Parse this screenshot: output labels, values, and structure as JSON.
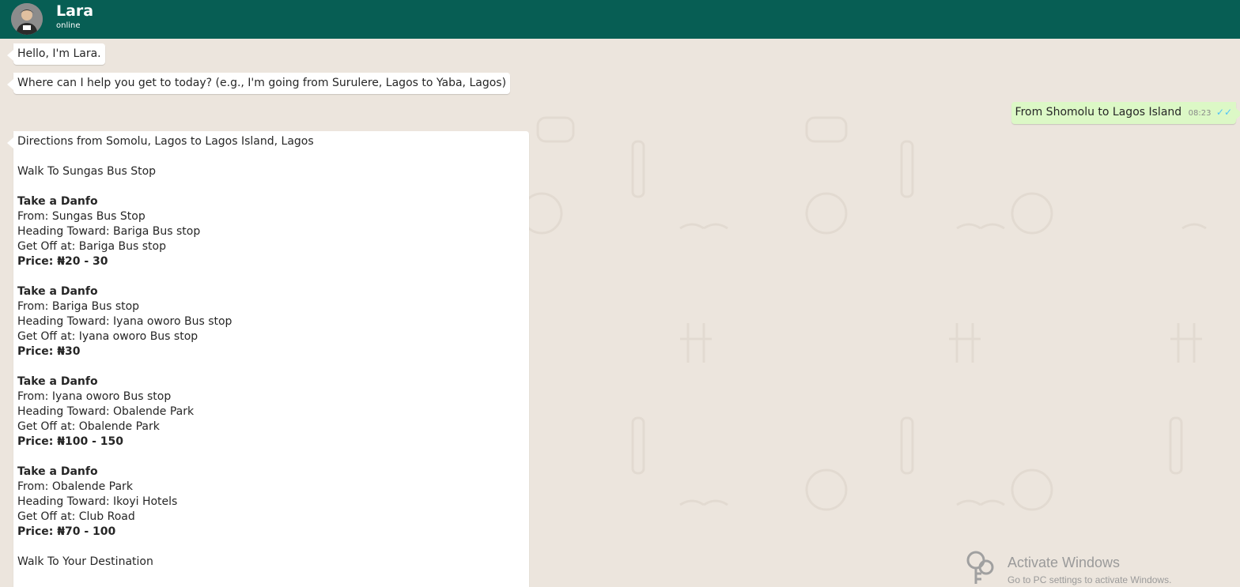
{
  "contact": {
    "name": "Lara",
    "status": "online"
  },
  "messages": {
    "greeting": "Hello, I'm Lara.",
    "prompt": "Where can I help you get to today? (e.g., I'm going from Surulere, Lagos to Yaba, Lagos)",
    "user": {
      "text": "From Shomolu to Lagos Island",
      "time": "08:23",
      "ticks": "✓✓"
    },
    "directions": [
      {
        "text": "Directions from Somolu, Lagos to Lagos Island, Lagos",
        "bold": false
      },
      {
        "text": "",
        "bold": false
      },
      {
        "text": "Walk To Sungas Bus Stop",
        "bold": false
      },
      {
        "text": "",
        "bold": false
      },
      {
        "text": "Take a Danfo",
        "bold": true
      },
      {
        "text": "From: Sungas Bus Stop",
        "bold": false
      },
      {
        "text": "Heading Toward: Bariga Bus stop",
        "bold": false
      },
      {
        "text": "Get Off at: Bariga Bus stop",
        "bold": false
      },
      {
        "text": "Price: ₦20 - 30",
        "bold": true
      },
      {
        "text": "",
        "bold": false
      },
      {
        "text": "Take a Danfo",
        "bold": true
      },
      {
        "text": "From: Bariga Bus stop",
        "bold": false
      },
      {
        "text": "Heading Toward: Iyana oworo Bus stop",
        "bold": false
      },
      {
        "text": "Get Off at: Iyana oworo Bus stop",
        "bold": false
      },
      {
        "text": "Price: ₦30",
        "bold": true
      },
      {
        "text": "",
        "bold": false
      },
      {
        "text": "Take a Danfo",
        "bold": true
      },
      {
        "text": "From: Iyana oworo Bus stop",
        "bold": false
      },
      {
        "text": "Heading Toward: Obalende Park",
        "bold": false
      },
      {
        "text": "Get Off at: Obalende Park",
        "bold": false
      },
      {
        "text": "Price: ₦100 - 150",
        "bold": true
      },
      {
        "text": "",
        "bold": false
      },
      {
        "text": "Take a Danfo",
        "bold": true
      },
      {
        "text": "From: Obalende Park",
        "bold": false
      },
      {
        "text": "Heading Toward: Ikoyi Hotels",
        "bold": false
      },
      {
        "text": "Get Off at: Club Road",
        "bold": false
      },
      {
        "text": "Price: ₦70 - 100",
        "bold": true
      },
      {
        "text": "",
        "bold": false
      },
      {
        "text": "Walk To Your Destination",
        "bold": false
      }
    ]
  },
  "watermark": {
    "title": "Activate Windows",
    "subtitle": "Go to PC settings to activate Windows."
  },
  "colors": {
    "header": "#075e54",
    "background": "#ece5dd",
    "outgoing": "#dcf8c6",
    "ticks": "#4fc3f7"
  },
  "icons": [
    "avatar",
    "read-receipt-ticks",
    "key-icon"
  ]
}
